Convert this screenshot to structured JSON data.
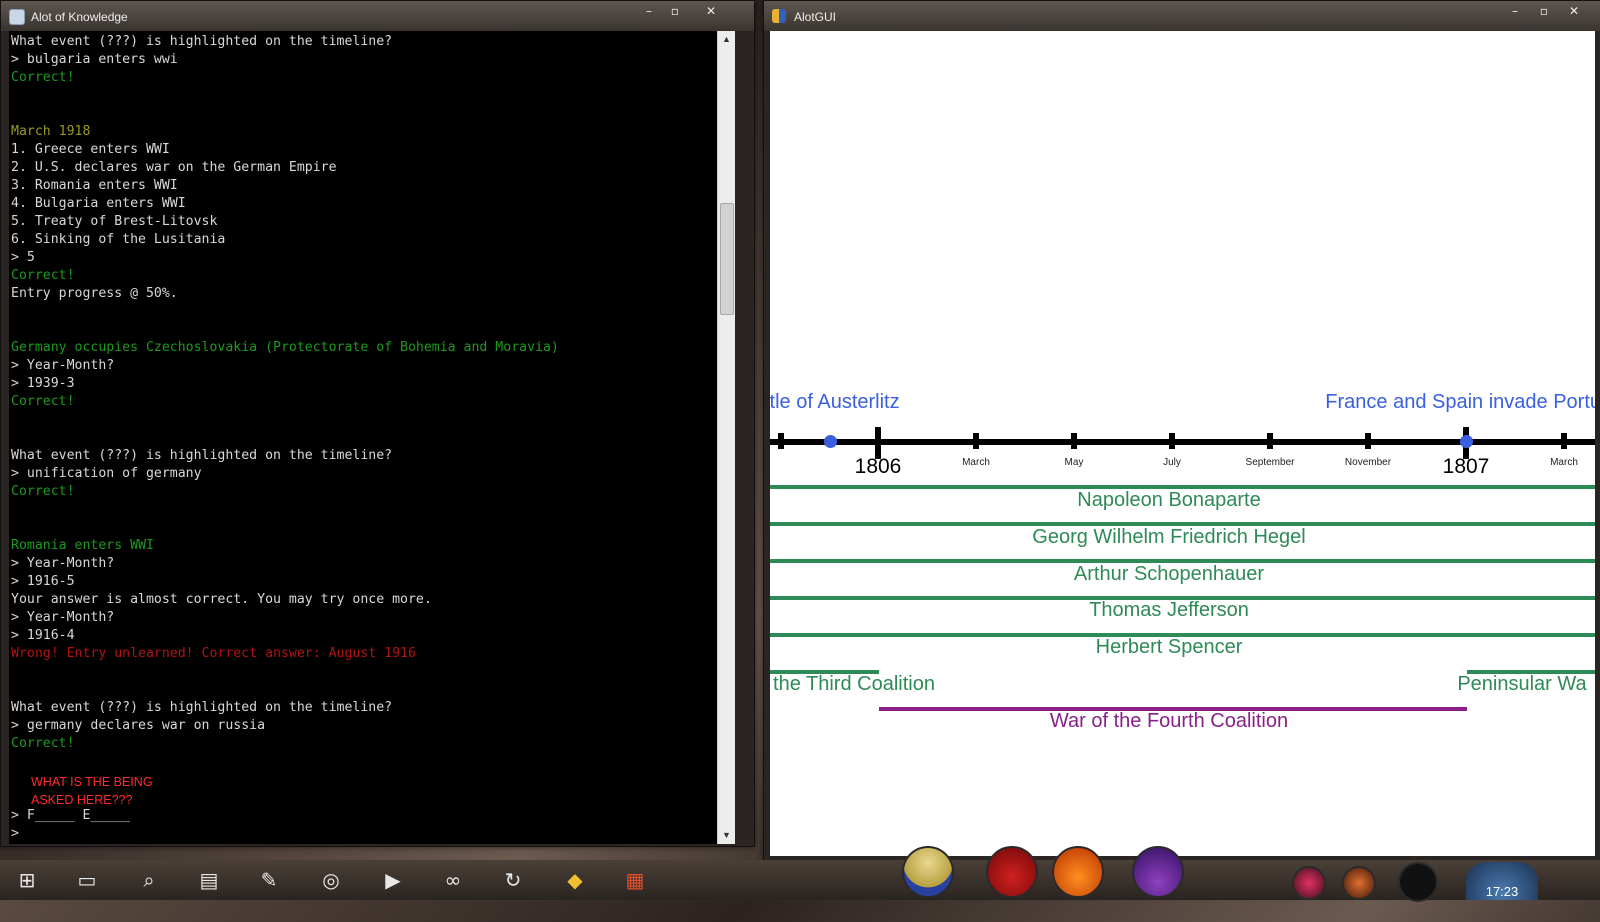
{
  "console_window": {
    "title": "Alot of Knowledge",
    "lines": [
      {
        "text": "What event (???) is highlighted on the timeline?",
        "color": "white"
      },
      {
        "text": "> bulgaria enters wwi",
        "color": "white"
      },
      {
        "text": "Correct!",
        "color": "green"
      },
      {
        "text": "",
        "color": "white"
      },
      {
        "text": "",
        "color": "white"
      },
      {
        "text": "March 1918",
        "color": "olive"
      },
      {
        "text": "1. Greece enters WWI",
        "color": "white"
      },
      {
        "text": "2. U.S. declares war on the German Empire",
        "color": "white"
      },
      {
        "text": "3. Romania enters WWI",
        "color": "white"
      },
      {
        "text": "4. Bulgaria enters WWI",
        "color": "white"
      },
      {
        "text": "5. Treaty of Brest-Litovsk",
        "color": "white"
      },
      {
        "text": "6. Sinking of the Lusitania",
        "color": "white"
      },
      {
        "text": "> 5",
        "color": "white"
      },
      {
        "text": "Correct!",
        "color": "green"
      },
      {
        "text": "Entry progress @ 50%.",
        "color": "white"
      },
      {
        "text": "",
        "color": "white"
      },
      {
        "text": "",
        "color": "white"
      },
      {
        "text": "Germany occupies Czechoslovakia (Protectorate of Bohemia and Moravia)",
        "color": "green"
      },
      {
        "text": "> Year-Month?",
        "color": "white"
      },
      {
        "text": "> 1939-3",
        "color": "white"
      },
      {
        "text": "Correct!",
        "color": "green"
      },
      {
        "text": "",
        "color": "white"
      },
      {
        "text": "",
        "color": "white"
      },
      {
        "text": "What event (???) is highlighted on the timeline?",
        "color": "white"
      },
      {
        "text": "> unification of germany",
        "color": "white"
      },
      {
        "text": "Correct!",
        "color": "green"
      },
      {
        "text": "",
        "color": "white"
      },
      {
        "text": "",
        "color": "white"
      },
      {
        "text": "Romania enters WWI",
        "color": "green"
      },
      {
        "text": "> Year-Month?",
        "color": "white"
      },
      {
        "text": "> 1916-5",
        "color": "white"
      },
      {
        "text": "Your answer is almost correct. You may try once more.",
        "color": "white"
      },
      {
        "text": "> Year-Month?",
        "color": "white"
      },
      {
        "text": "> 1916-4",
        "color": "white"
      },
      {
        "text": "Wrong! Entry unlearned! Correct answer: August 1916",
        "color": "red"
      },
      {
        "text": "",
        "color": "white"
      },
      {
        "text": "",
        "color": "white"
      },
      {
        "text": "What event (???) is highlighted on the timeline?",
        "color": "white"
      },
      {
        "text": "> germany declares war on russia",
        "color": "white"
      },
      {
        "text": "Correct!",
        "color": "green"
      },
      {
        "text": "",
        "color": "white"
      },
      {
        "text": "",
        "color": "white"
      },
      {
        "text": "",
        "color": "white"
      },
      {
        "text": "> F_____ E_____",
        "color": "white"
      },
      {
        "text": ">",
        "color": "white"
      }
    ],
    "annotation": "WHAT IS THE BEING ASKED HERE???"
  },
  "gui_window": {
    "title": "AlotGUI",
    "top_events": [
      {
        "label": "ttle of Austerlitz",
        "anchor": "left"
      },
      {
        "label": "France and Spain invade Portu",
        "anchor": "right"
      }
    ],
    "year_labels": [
      "1806",
      "1807"
    ],
    "month_labels": [
      "March",
      "May",
      "July",
      "September",
      "November",
      "March"
    ],
    "people": [
      "Napoleon Bonaparte",
      "Georg Wilhelm Friedrich Hegel",
      "Arthur Schopenhauer",
      "Thomas Jefferson",
      "Herbert Spencer"
    ],
    "wars": {
      "left": "the Third Coalition",
      "right": "Peninsular Wa",
      "center": "War of the Fourth Coalition"
    },
    "colors": {
      "event": "#3a60e0",
      "person": "#2e8a56",
      "war": "#8a1e8a"
    }
  },
  "window_buttons": {
    "minimize": "–",
    "maximize": "▫",
    "close": "✕"
  },
  "taskbar": {
    "icons": [
      "start-icon",
      "desktop-icon",
      "search-icon",
      "document-icon",
      "pen-icon",
      "chrome-icon",
      "play-icon",
      "link-icon",
      "swirl-icon",
      "python-icon",
      "palette-icon"
    ],
    "clock": "17:23"
  }
}
